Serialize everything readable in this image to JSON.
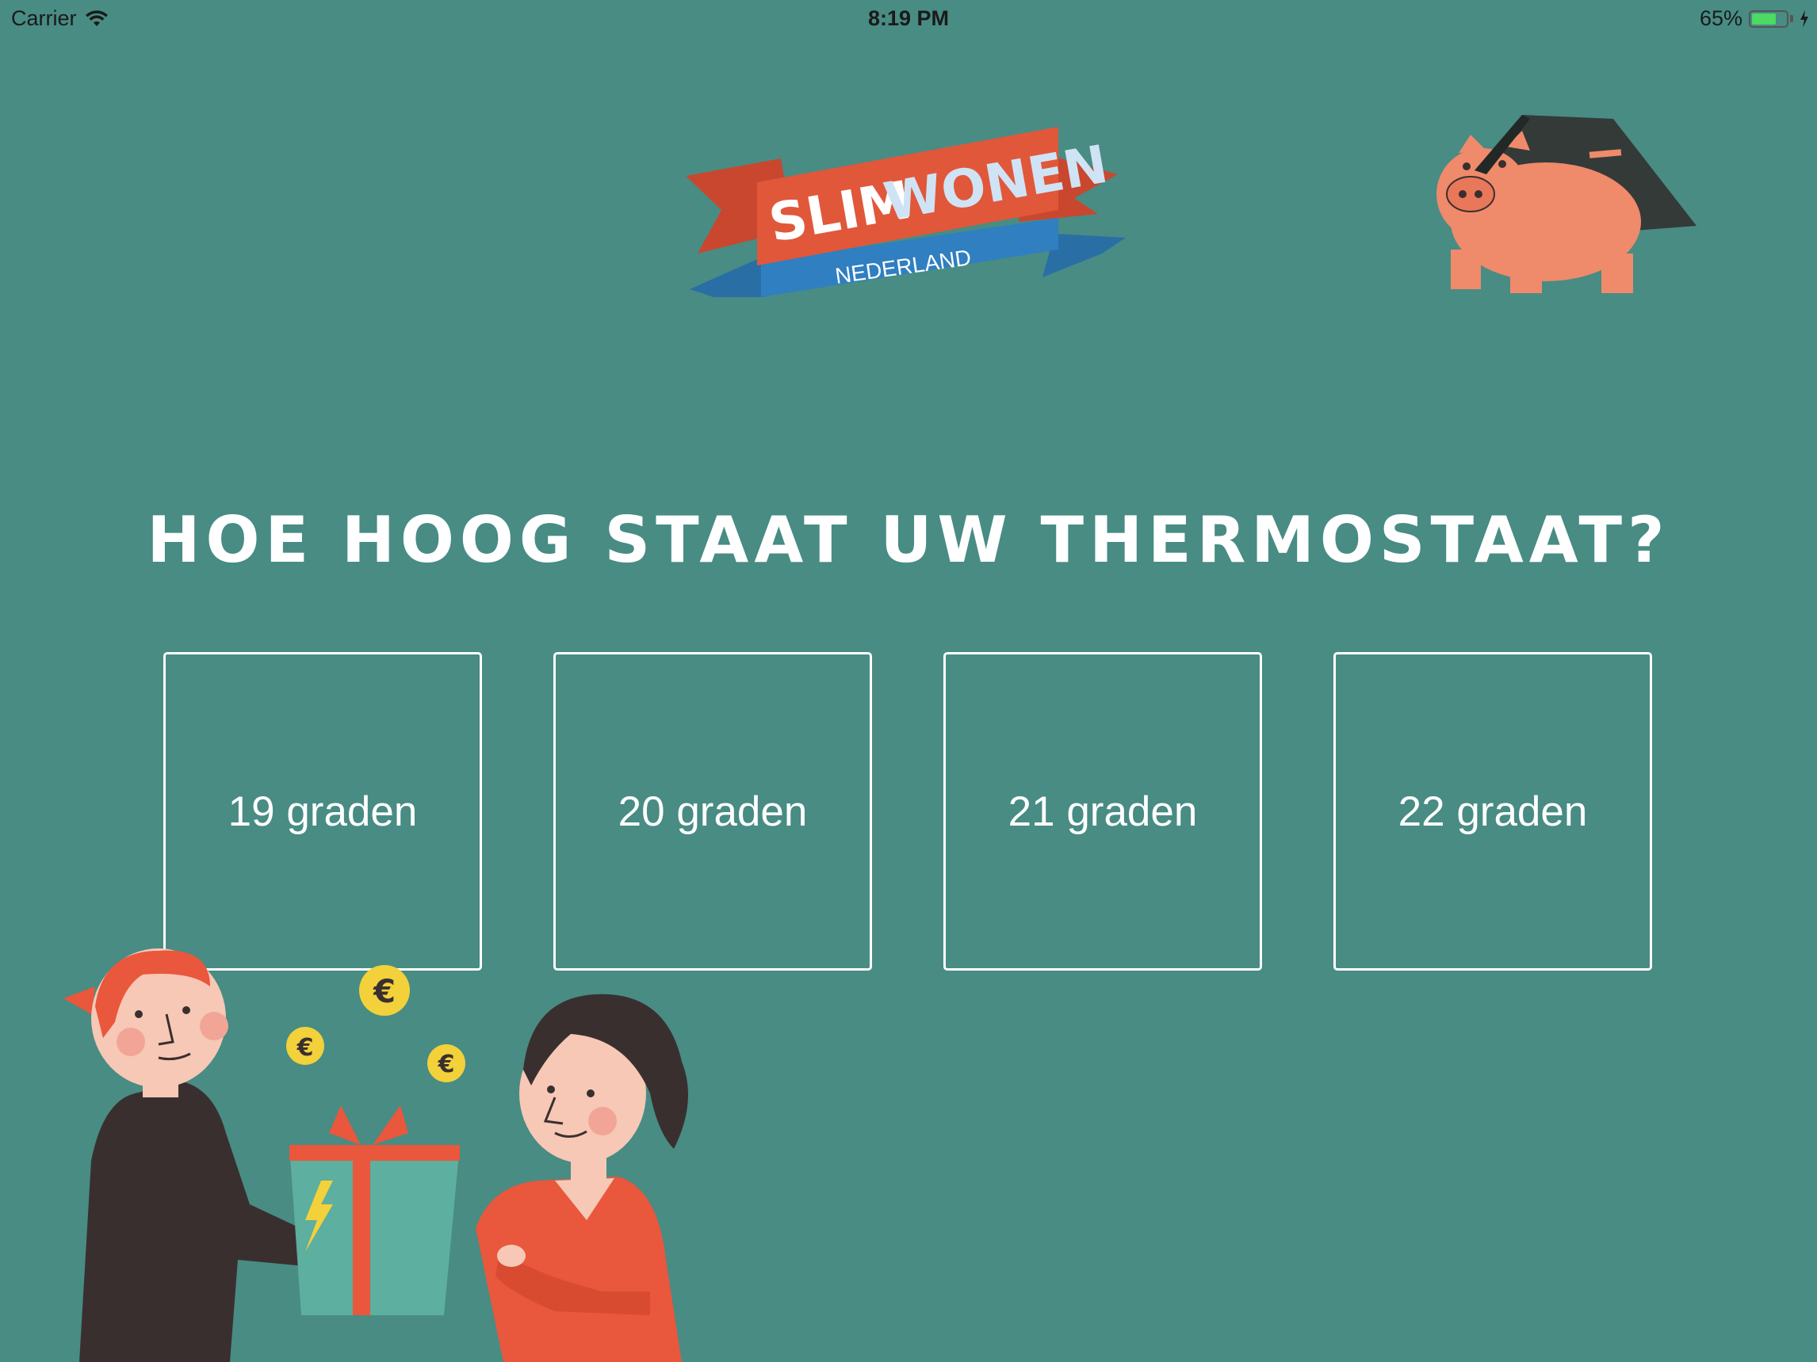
{
  "status_bar": {
    "carrier": "Carrier",
    "time": "8:19 PM",
    "battery_percent": "65%",
    "battery_level": 0.65
  },
  "logo": {
    "line1_part1": "SLIM",
    "line1_part2": "WONEN",
    "line2": "NEDERLAND"
  },
  "question": "HOE HOOG STAAT UW THERMOSTAAT?",
  "options": [
    {
      "label": "19 graden"
    },
    {
      "label": "20 graden"
    },
    {
      "label": "21 graden"
    },
    {
      "label": "22 graden"
    }
  ],
  "colors": {
    "background": "#488c84",
    "accent_orange": "#e1573a",
    "accent_blue": "#2f7fc1",
    "pig": "#ef8a6b",
    "coin": "#f2d13a"
  }
}
